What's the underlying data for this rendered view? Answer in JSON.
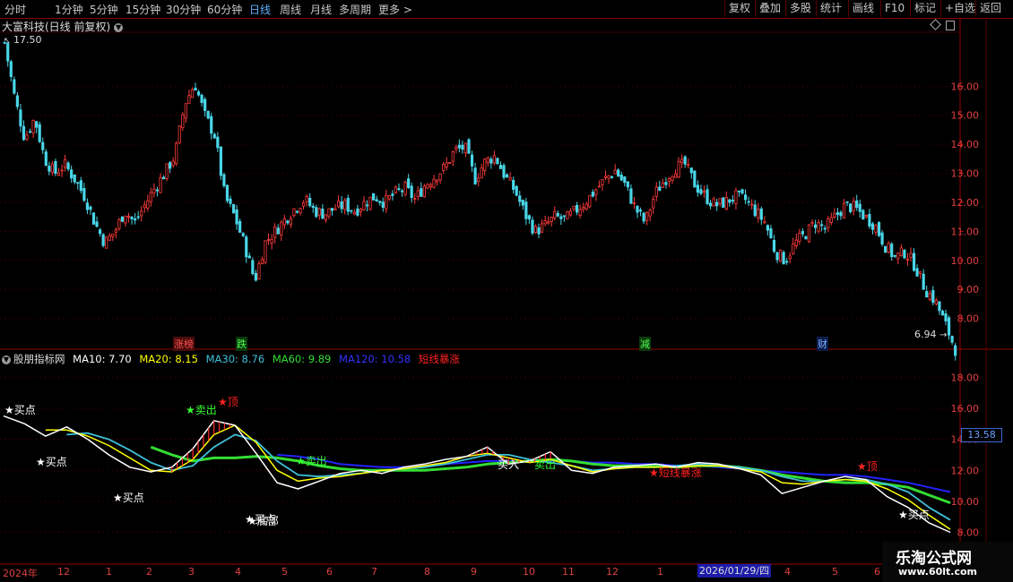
{
  "toolbar": {
    "periods": [
      "分时",
      "1分钟",
      "5分钟",
      "15分钟",
      "30分钟",
      "60分钟",
      "日线",
      "周线",
      "月线",
      "多周期",
      "更多 >"
    ],
    "active_period": "日线",
    "buttons": [
      "复权",
      "叠加",
      "多股",
      "统计",
      "画线",
      "F10",
      "标记",
      "+自选",
      "返回"
    ]
  },
  "stock_header": {
    "title": "大富科技(日线 前复权)"
  },
  "price_labels": {
    "high": "17.50",
    "low": "6.94"
  },
  "events": [
    {
      "label": "涨榜",
      "color": "#ff5050",
      "bg": "#5a1010"
    },
    {
      "label": "跌",
      "color": "#50ff50",
      "bg": "#104010"
    },
    {
      "label": "减",
      "color": "#50ff50",
      "bg": "#104010"
    },
    {
      "label": "财",
      "color": "#7ab0ff",
      "bg": "#102050"
    }
  ],
  "indicator": {
    "name": "股朋指标网",
    "items": [
      {
        "text": "MA10: 7.70",
        "color": "#ffffff"
      },
      {
        "text": "MA20: 8.15",
        "color": "#ffff00"
      },
      {
        "text": "MA30: 8.76",
        "color": "#3fc0d8"
      },
      {
        "text": "MA60: 9.89",
        "color": "#33dd33"
      },
      {
        "text": "MA120: 10.58",
        "color": "#2222ff"
      },
      {
        "text": "短线暴涨",
        "color": "#ff2222"
      }
    ]
  },
  "current_price": "13.58",
  "signals": [
    {
      "text": "★买点",
      "color": "#ffffff"
    },
    {
      "text": "★买点",
      "color": "#ffffff"
    },
    {
      "text": "★买点",
      "color": "#ffffff"
    },
    {
      "text": "★卖出",
      "color": "#33ff33"
    },
    {
      "text": "★顶",
      "color": "#ff2222"
    },
    {
      "text": "★买点",
      "color": "#ffffff"
    },
    {
      "text": "★底部",
      "color": "#ffffff"
    },
    {
      "text": "★卖出",
      "color": "#33ff33"
    },
    {
      "text": "买入",
      "color": "#ffffff"
    },
    {
      "text": "卖出",
      "color": "#33ff33"
    },
    {
      "text": "★短线暴涨",
      "color": "#ff2222"
    },
    {
      "text": "★顶",
      "color": "#ff2222"
    },
    {
      "text": "★买点",
      "color": "#ffffff"
    }
  ],
  "x_axis": {
    "labels": [
      "2024年",
      "12",
      "1",
      "2",
      "3",
      "4",
      "5",
      "6",
      "7",
      "8",
      "9",
      "10",
      "11",
      "12",
      "1",
      "4",
      "5",
      "6"
    ],
    "highlight": "2026/01/29/四"
  },
  "watermark": {
    "line1": "乐淘公式网",
    "line2": "www.60lt.com"
  },
  "chart_data": [
    {
      "type": "candlestick",
      "title": "大富科技(日线 前复权)",
      "yticks": [
        8.0,
        9.0,
        10.0,
        11.0,
        12.0,
        13.0,
        14.0,
        15.0,
        16.0
      ],
      "ylim": [
        7.0,
        17.8
      ],
      "closes": [
        17.5,
        15.6,
        14.2,
        14.9,
        13.5,
        13.0,
        13.3,
        12.8,
        12.2,
        11.3,
        10.6,
        11.0,
        11.7,
        11.3,
        11.9,
        12.5,
        13.0,
        13.6,
        15.4,
        16.1,
        15.0,
        14.3,
        12.2,
        11.5,
        10.5,
        9.3,
        10.6,
        11.0,
        11.4,
        11.8,
        12.1,
        11.7,
        11.6,
        11.8,
        11.9,
        11.7,
        12.0,
        12.2,
        12.0,
        12.3,
        12.5,
        12.1,
        12.6,
        12.9,
        13.2,
        13.8,
        13.9,
        12.8,
        13.4,
        13.6,
        12.9,
        12.4,
        11.6,
        11.0,
        11.2,
        11.5,
        11.4,
        11.7,
        12.0,
        12.4,
        12.8,
        13.1,
        12.6,
        11.8,
        11.3,
        12.3,
        12.8,
        13.2,
        13.3,
        12.6,
        12.2,
        11.9,
        12.0,
        12.2,
        12.1,
        11.7,
        11.3,
        10.3,
        10.0,
        10.6,
        10.9,
        11.3,
        11.1,
        11.5,
        11.9,
        11.8,
        11.5,
        11.2,
        10.5,
        10.1,
        10.3,
        9.8,
        9.0,
        8.6,
        7.8,
        6.94
      ]
    },
    {
      "type": "line",
      "title": "股朋指标网",
      "yticks": [
        8.0,
        10.0,
        12.0,
        14.0,
        16.0,
        18.0
      ],
      "ylim": [
        7.8,
        19.0
      ],
      "series": [
        {
          "name": "MA10",
          "color": "#ffffff",
          "values": [
            15.5,
            15.0,
            14.2,
            14.8,
            14.0,
            13.0,
            12.2,
            11.9,
            12.2,
            13.4,
            15.2,
            14.9,
            13.1,
            11.2,
            10.8,
            11.3,
            11.8,
            12.0,
            11.8,
            12.2,
            12.4,
            12.7,
            12.9,
            13.5,
            12.4,
            12.6,
            13.2,
            12.0,
            11.8,
            12.2,
            12.3,
            12.4,
            12.2,
            12.5,
            12.4,
            12.1,
            11.7,
            10.5,
            10.9,
            11.3,
            11.6,
            11.4,
            10.3,
            9.6,
            8.6,
            8.0
          ]
        },
        {
          "name": "MA20",
          "color": "#ffff00",
          "values": [
            null,
            null,
            14.6,
            14.6,
            14.2,
            13.6,
            12.8,
            12.0,
            11.9,
            12.7,
            14.3,
            14.9,
            13.8,
            12.0,
            11.3,
            11.5,
            11.6,
            11.8,
            12.0,
            12.1,
            12.3,
            12.5,
            12.9,
            13.1,
            12.8,
            12.5,
            12.7,
            12.3,
            11.9,
            12.1,
            12.2,
            12.2,
            12.2,
            12.3,
            12.3,
            12.1,
            11.9,
            11.2,
            11.1,
            11.3,
            11.4,
            11.3,
            10.8,
            10.1,
            9.1,
            8.2
          ]
        },
        {
          "name": "MA30",
          "color": "#3fc0d8",
          "values": [
            null,
            null,
            null,
            14.3,
            14.4,
            14.0,
            13.3,
            12.5,
            12.0,
            12.3,
            13.5,
            14.3,
            13.9,
            12.6,
            11.7,
            11.6,
            11.7,
            11.8,
            12.0,
            12.1,
            12.2,
            12.4,
            12.7,
            13.0,
            13.0,
            12.7,
            12.5,
            12.3,
            12.0,
            12.1,
            12.2,
            12.2,
            12.3,
            12.4,
            12.3,
            12.2,
            12.0,
            11.6,
            11.3,
            11.3,
            11.4,
            11.4,
            11.1,
            10.6,
            9.6,
            8.8
          ]
        },
        {
          "name": "MA60",
          "color": "#33dd33",
          "values": [
            null,
            null,
            null,
            null,
            null,
            null,
            null,
            13.5,
            13.0,
            12.6,
            12.8,
            12.8,
            12.9,
            12.8,
            12.6,
            12.3,
            12.1,
            12.0,
            12.0,
            12.0,
            12.0,
            12.1,
            12.2,
            12.4,
            12.5,
            12.6,
            12.7,
            12.6,
            12.4,
            12.3,
            12.3,
            12.3,
            12.2,
            12.3,
            12.3,
            12.2,
            12.0,
            11.7,
            11.5,
            11.3,
            11.2,
            11.2,
            11.1,
            10.9,
            10.4,
            9.9
          ]
        },
        {
          "name": "MA120",
          "color": "#2222ff",
          "values": [
            null,
            null,
            null,
            null,
            null,
            null,
            null,
            null,
            null,
            null,
            null,
            null,
            null,
            13.0,
            12.9,
            12.7,
            12.4,
            12.3,
            12.2,
            12.2,
            12.3,
            12.4,
            12.5,
            12.6,
            12.6,
            12.6,
            12.6,
            12.6,
            12.5,
            12.5,
            12.4,
            12.4,
            12.3,
            12.3,
            12.2,
            12.1,
            12.0,
            11.9,
            11.8,
            11.7,
            11.7,
            11.6,
            11.4,
            11.2,
            10.9,
            10.6
          ]
        }
      ]
    }
  ]
}
